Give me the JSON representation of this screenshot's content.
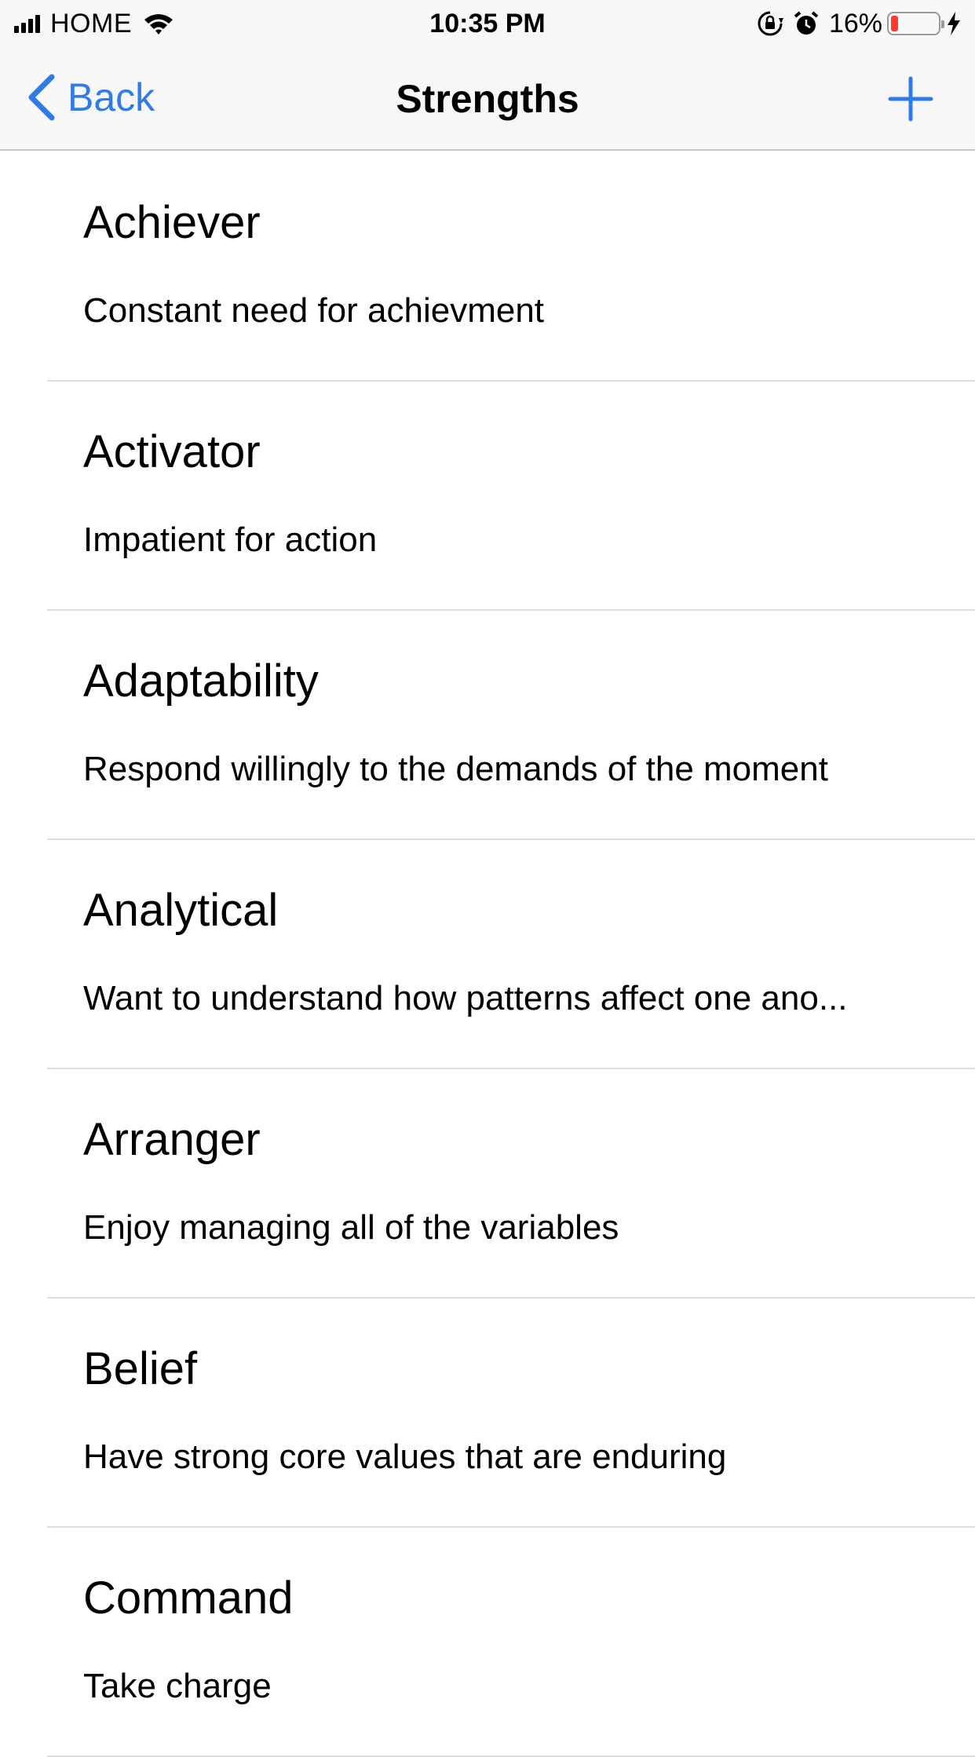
{
  "status_bar": {
    "carrier": "HOME",
    "time": "10:35 PM",
    "battery_percent": "16%",
    "battery_level": 0.16,
    "icons": [
      "signal-icon",
      "wifi-icon",
      "rotation-lock-icon",
      "alarm-icon",
      "battery-icon",
      "charging-icon"
    ]
  },
  "nav": {
    "back_label": "Back",
    "title": "Strengths",
    "add_icon": "plus-icon",
    "accent_color": "#2f7be8"
  },
  "strengths": [
    {
      "title": "Achiever",
      "subtitle": "Constant need for achievment"
    },
    {
      "title": "Activator",
      "subtitle": "Impatient for action"
    },
    {
      "title": "Adaptability",
      "subtitle": "Respond willingly to the demands of the moment"
    },
    {
      "title": "Analytical",
      "subtitle": "Want to understand how patterns affect one ano..."
    },
    {
      "title": "Arranger",
      "subtitle": "Enjoy managing all of the variables"
    },
    {
      "title": "Belief",
      "subtitle": "Have strong core values that are enduring"
    },
    {
      "title": "Command",
      "subtitle": "Take charge"
    }
  ]
}
